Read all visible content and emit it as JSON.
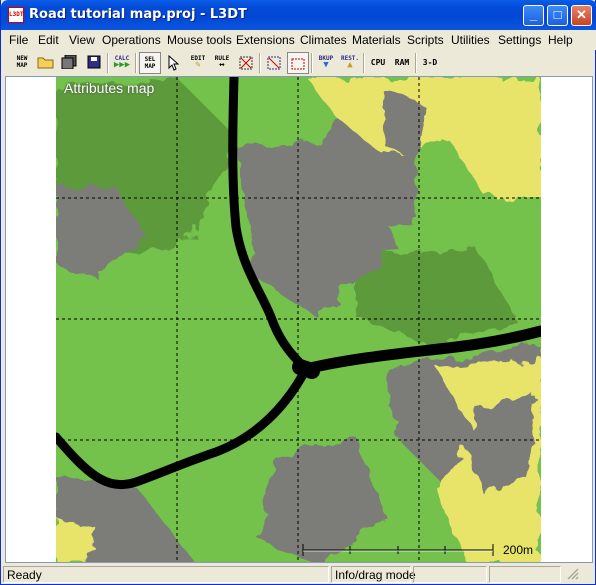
{
  "window": {
    "title": "Road tutorial map.proj - L3DT",
    "icon_text": "L3DT",
    "buttons": {
      "minimize": "_",
      "maximize": "□",
      "close": "✕"
    }
  },
  "menu": [
    "File",
    "Edit",
    "View",
    "Operations",
    "Mouse tools",
    "Extensions",
    "Climates",
    "Materials",
    "Scripts",
    "Utilities",
    "Settings",
    "Help"
  ],
  "toolbar": {
    "new_map": "NEW\nMAP",
    "open": "open-folder-icon",
    "save_all": "save-all-icon",
    "save": "save-icon",
    "calc": "CALC",
    "sel_map": "SEL\nMAP",
    "pointer": "pointer-icon",
    "edit": "EDIT",
    "rule": "RULE",
    "select_tool": "select-region-icon",
    "zoom_grid": "grid-select-icon",
    "region": "region-icon",
    "backup": "BKUP",
    "restore": "REST.",
    "cpu": "CPU",
    "ram": "RAM",
    "three_d": "3-D"
  },
  "map": {
    "label": "Attributes map",
    "scale_label": "200m",
    "colors": {
      "grass": "#74c14c",
      "dark_grass": "#5d9a3b",
      "rock": "#7b7b78",
      "sand": "#e8e46a",
      "road": "#000000"
    }
  },
  "status": {
    "left": "Ready",
    "mode": "Info/drag mode"
  }
}
